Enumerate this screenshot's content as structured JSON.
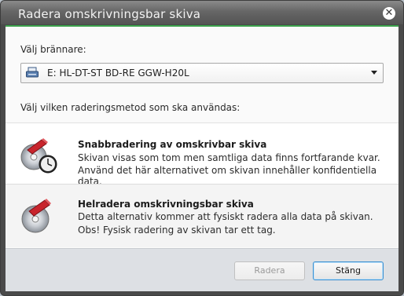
{
  "window": {
    "title": "Radera omskrivningsbar skiva"
  },
  "burner": {
    "label": "Välj brännare:",
    "selected": "E: HL-DT-ST BD-RE  GGW-H20L"
  },
  "method_label": "Välj vilken raderingsmetod som ska användas:",
  "options": [
    {
      "title": "Snabbradering av omskrivbar skiva",
      "line1": "Skivan visas som tom men samtliga data finns fortfarande kvar.",
      "line2": "Använd det här alternativet om skivan innehåller konfidentiella data."
    },
    {
      "title": "Helradera omskrivningsbar skiva",
      "line1": "Detta alternativ kommer att fysiskt radera alla data på skivan.",
      "line2": "Obs! Fysisk radering av skivan tar ett tag."
    }
  ],
  "buttons": {
    "erase": "Radera",
    "close": "Stäng"
  },
  "colors": {
    "accent_line": "#3ba14b",
    "default_button_border": "#3b8fd0"
  }
}
